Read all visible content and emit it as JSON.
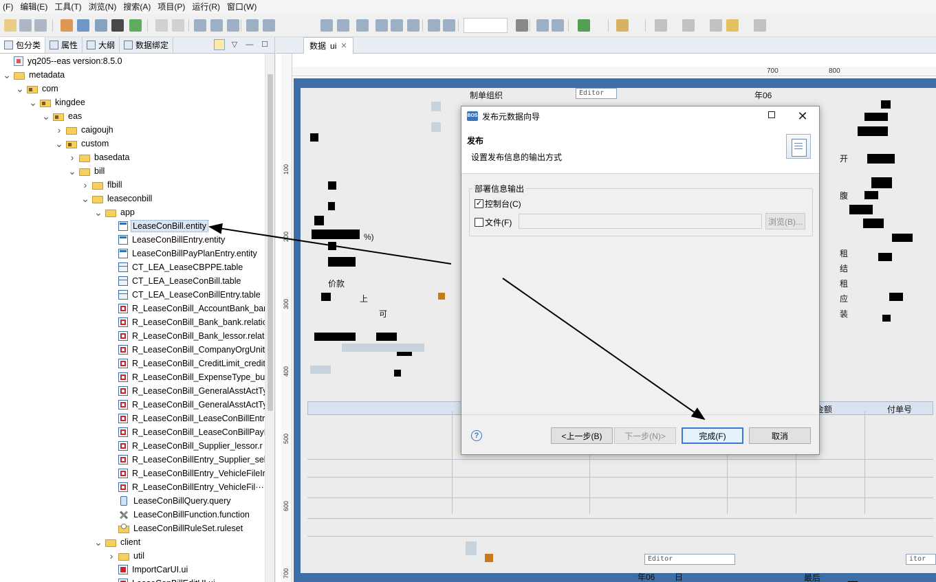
{
  "menubar": {
    "items": [
      "(F)",
      "编辑(E)",
      "工具(T)",
      "浏览(N)",
      "搜索(A)",
      "项目(P)",
      "运行(R)",
      "窗口(W)"
    ]
  },
  "left_panel": {
    "tabs": [
      {
        "label": "包分类",
        "active": true
      },
      {
        "label": "属性",
        "active": false
      },
      {
        "label": "大纲",
        "active": false
      },
      {
        "label": "数据绑定",
        "active": false
      }
    ],
    "tree": [
      {
        "label": "yq205--eas version:8.5.0",
        "depth": 0,
        "toggle": "",
        "icon": "project-icon"
      },
      {
        "label": "metadata",
        "depth": 0,
        "toggle": "expanded",
        "icon": "folder-icon"
      },
      {
        "label": "com",
        "depth": 1,
        "toggle": "expanded",
        "icon": "package-icon"
      },
      {
        "label": "kingdee",
        "depth": 2,
        "toggle": "expanded",
        "icon": "package-icon"
      },
      {
        "label": "eas",
        "depth": 3,
        "toggle": "expanded",
        "icon": "package-icon"
      },
      {
        "label": "caigoujh",
        "depth": 4,
        "toggle": "collapsed",
        "icon": "folder-icon"
      },
      {
        "label": "custom",
        "depth": 4,
        "toggle": "expanded",
        "icon": "package-icon"
      },
      {
        "label": "basedata",
        "depth": 5,
        "toggle": "collapsed",
        "icon": "folder-icon"
      },
      {
        "label": "bill",
        "depth": 5,
        "toggle": "expanded",
        "icon": "folder-icon"
      },
      {
        "label": "flbill",
        "depth": 6,
        "toggle": "collapsed",
        "icon": "folder-icon"
      },
      {
        "label": "leaseconbill",
        "depth": 6,
        "toggle": "expanded",
        "icon": "folder-icon"
      },
      {
        "label": "app",
        "depth": 7,
        "toggle": "expanded",
        "icon": "folder-icon"
      },
      {
        "label": "LeaseConBill.entity",
        "depth": 8,
        "toggle": "",
        "icon": "entity-icon",
        "selected": true
      },
      {
        "label": "LeaseConBillEntry.entity",
        "depth": 8,
        "toggle": "",
        "icon": "entity-icon"
      },
      {
        "label": "LeaseConBillPayPlanEntry.entity",
        "depth": 8,
        "toggle": "",
        "icon": "entity-icon"
      },
      {
        "label": "CT_LEA_LeaseCBPPE.table",
        "depth": 8,
        "toggle": "",
        "icon": "table-icon"
      },
      {
        "label": "CT_LEA_LeaseConBill.table",
        "depth": 8,
        "toggle": "",
        "icon": "table-icon"
      },
      {
        "label": "CT_LEA_LeaseConBillEntry.table",
        "depth": 8,
        "toggle": "",
        "icon": "table-icon"
      },
      {
        "label": "R_LeaseConBill_AccountBank_ban",
        "depth": 8,
        "toggle": "",
        "icon": "relation-icon"
      },
      {
        "label": "R_LeaseConBill_Bank_bank.relatic",
        "depth": 8,
        "toggle": "",
        "icon": "relation-icon"
      },
      {
        "label": "R_LeaseConBill_Bank_lessor.relati",
        "depth": 8,
        "toggle": "",
        "icon": "relation-icon"
      },
      {
        "label": "R_LeaseConBill_CompanyOrgUnit",
        "depth": 8,
        "toggle": "",
        "icon": "relation-icon"
      },
      {
        "label": "R_LeaseConBill_CreditLimit_credit",
        "depth": 8,
        "toggle": "",
        "icon": "relation-icon"
      },
      {
        "label": "R_LeaseConBill_ExpenseType_buc",
        "depth": 8,
        "toggle": "",
        "icon": "relation-icon"
      },
      {
        "label": "R_LeaseConBill_GeneralAsstActTy",
        "depth": 8,
        "toggle": "",
        "icon": "relation-icon"
      },
      {
        "label": "R_LeaseConBill_GeneralAsstActTy",
        "depth": 8,
        "toggle": "",
        "icon": "relation-icon"
      },
      {
        "label": "R_LeaseConBill_LeaseConBillEntry",
        "depth": 8,
        "toggle": "",
        "icon": "relation-icon"
      },
      {
        "label": "R_LeaseConBill_LeaseConBillPayF",
        "depth": 8,
        "toggle": "",
        "icon": "relation-icon"
      },
      {
        "label": "R_LeaseConBill_Supplier_lessor.r",
        "depth": 8,
        "toggle": "",
        "icon": "relation-icon"
      },
      {
        "label": "R_LeaseConBillEntry_Supplier_sel",
        "depth": 8,
        "toggle": "",
        "icon": "relation-icon"
      },
      {
        "label": "R_LeaseConBillEntry_VehicleFileIr",
        "depth": 8,
        "toggle": "",
        "icon": "relation-icon"
      },
      {
        "label": "R_LeaseConBillEntry_VehicleFil···",
        "depth": 8,
        "toggle": "",
        "icon": "relation-icon"
      },
      {
        "label": "LeaseConBillQuery.query",
        "depth": 8,
        "toggle": "",
        "icon": "query-icon"
      },
      {
        "label": "LeaseConBillFunction.function",
        "depth": 8,
        "toggle": "",
        "icon": "function-icon"
      },
      {
        "label": "LeaseConBillRuleSet.ruleset",
        "depth": 8,
        "toggle": "",
        "icon": "ruleset-icon"
      },
      {
        "label": "client",
        "depth": 7,
        "toggle": "expanded",
        "icon": "folder-icon"
      },
      {
        "label": "util",
        "depth": 8,
        "toggle": "collapsed",
        "icon": "folder-icon"
      },
      {
        "label": "ImportCarUI.ui",
        "depth": 8,
        "toggle": "",
        "icon": "ui-icon"
      },
      {
        "label": "LeaseConBillEditUI.ui",
        "depth": 8,
        "toggle": "",
        "icon": "ui-icon"
      }
    ]
  },
  "editor": {
    "tab_label": "数据",
    "tab_suffix": "ui",
    "ruler_h": [
      "700",
      "800"
    ],
    "ruler_v": [
      "100",
      "200",
      "300",
      "400",
      "500",
      "600",
      "700"
    ],
    "form_labels": {
      "editor_1": "Editor",
      "editor_2": "Editor",
      "editor_3": "itor",
      "label_1": "制单组织",
      "label_2": "年06",
      "label_3": "开",
      "label_4": "腹",
      "label_5": "租",
      "label_6": "结",
      "label_7": "租",
      "label_8": "应",
      "label_9": "装",
      "label_10": "价款",
      "label_11": "付金额",
      "label_12": "付单号",
      "label_13": "年06",
      "label_14": "日",
      "label_15": "最后",
      "label_16": "%)",
      "label_17": "上",
      "label_18": "可"
    }
  },
  "dialog": {
    "title": "发布元数据向导",
    "app_icon_text": "BOS",
    "header_title": "发布",
    "header_desc": "设置发布信息的输出方式",
    "group_title": "部署信息输出",
    "console_label": "控制台(C)",
    "console_checked": true,
    "file_label": "文件(F)",
    "file_checked": false,
    "file_path": "",
    "browse_label": "浏览(B)...",
    "buttons": {
      "back": "<上一步(B)",
      "next": "下一步(N)>",
      "finish": "完成(F)",
      "cancel": "取消"
    }
  },
  "colors": {
    "canvas_blue": "#3d6ea6",
    "selection": "#dbe6f5",
    "default_button_border": "#3a78d6",
    "annotation_arrow": "#000000"
  }
}
